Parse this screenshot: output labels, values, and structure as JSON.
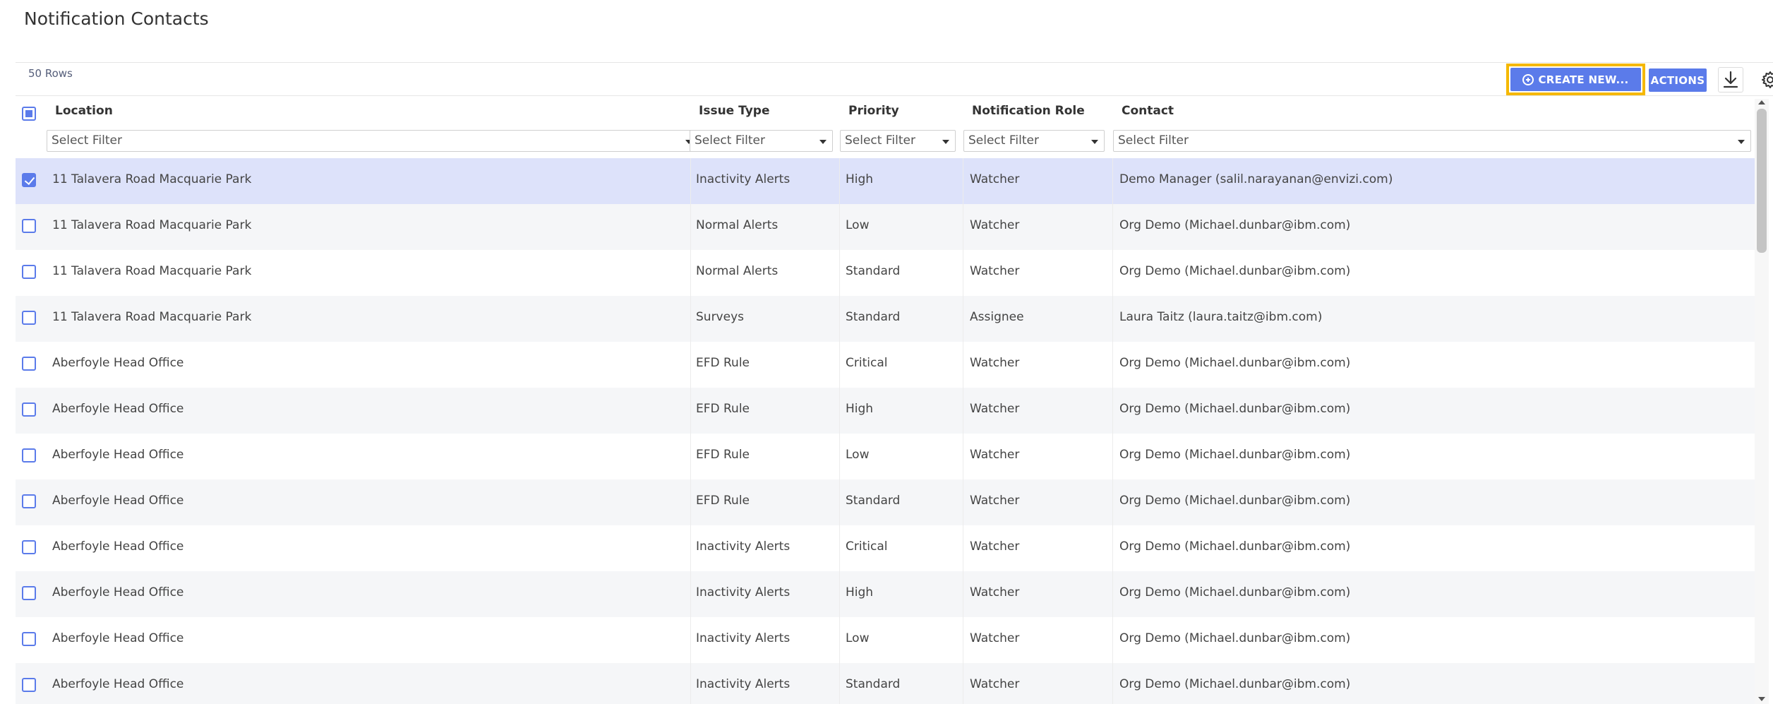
{
  "page": {
    "title": "Notification Contacts"
  },
  "toolbar": {
    "row_count": "50 Rows",
    "create_label": "CREATE NEW...",
    "actions_label": "ACTIONS",
    "download_icon": "download-icon",
    "settings_icon": "gear-icon"
  },
  "columns": [
    {
      "label": "Location",
      "filter": "Select Filter"
    },
    {
      "label": "Issue Type",
      "filter": "Select Filter"
    },
    {
      "label": "Priority",
      "filter": "Select Filter"
    },
    {
      "label": "Notification Role",
      "filter": "Select Filter"
    },
    {
      "label": "Contact",
      "filter": "Select Filter"
    }
  ],
  "rows": [
    {
      "checked": true,
      "location": "11 Talavera Road Macquarie Park",
      "issue_type": "Inactivity Alerts",
      "priority": "High",
      "role": "Watcher",
      "contact": "Demo Manager (salil.narayanan@envizi.com)"
    },
    {
      "checked": false,
      "location": "11 Talavera Road Macquarie Park",
      "issue_type": "Normal Alerts",
      "priority": "Low",
      "role": "Watcher",
      "contact": "Org Demo (Michael.dunbar@ibm.com)"
    },
    {
      "checked": false,
      "location": "11 Talavera Road Macquarie Park",
      "issue_type": "Normal Alerts",
      "priority": "Standard",
      "role": "Watcher",
      "contact": "Org Demo (Michael.dunbar@ibm.com)"
    },
    {
      "checked": false,
      "location": "11 Talavera Road Macquarie Park",
      "issue_type": "Surveys",
      "priority": "Standard",
      "role": "Assignee",
      "contact": "Laura Taitz (laura.taitz@ibm.com)"
    },
    {
      "checked": false,
      "location": "Aberfoyle Head Office",
      "issue_type": "EFD Rule",
      "priority": "Critical",
      "role": "Watcher",
      "contact": "Org Demo (Michael.dunbar@ibm.com)"
    },
    {
      "checked": false,
      "location": "Aberfoyle Head Office",
      "issue_type": "EFD Rule",
      "priority": "High",
      "role": "Watcher",
      "contact": "Org Demo (Michael.dunbar@ibm.com)"
    },
    {
      "checked": false,
      "location": "Aberfoyle Head Office",
      "issue_type": "EFD Rule",
      "priority": "Low",
      "role": "Watcher",
      "contact": "Org Demo (Michael.dunbar@ibm.com)"
    },
    {
      "checked": false,
      "location": "Aberfoyle Head Office",
      "issue_type": "EFD Rule",
      "priority": "Standard",
      "role": "Watcher",
      "contact": "Org Demo (Michael.dunbar@ibm.com)"
    },
    {
      "checked": false,
      "location": "Aberfoyle Head Office",
      "issue_type": "Inactivity Alerts",
      "priority": "Critical",
      "role": "Watcher",
      "contact": "Org Demo (Michael.dunbar@ibm.com)"
    },
    {
      "checked": false,
      "location": "Aberfoyle Head Office",
      "issue_type": "Inactivity Alerts",
      "priority": "High",
      "role": "Watcher",
      "contact": "Org Demo (Michael.dunbar@ibm.com)"
    },
    {
      "checked": false,
      "location": "Aberfoyle Head Office",
      "issue_type": "Inactivity Alerts",
      "priority": "Low",
      "role": "Watcher",
      "contact": "Org Demo (Michael.dunbar@ibm.com)"
    },
    {
      "checked": false,
      "location": "Aberfoyle Head Office",
      "issue_type": "Inactivity Alerts",
      "priority": "Standard",
      "role": "Watcher",
      "contact": "Org Demo (Michael.dunbar@ibm.com)"
    }
  ],
  "colors": {
    "accent": "#5b7bea",
    "highlight": "#f5b800",
    "selected_row": "#dde2fa"
  }
}
